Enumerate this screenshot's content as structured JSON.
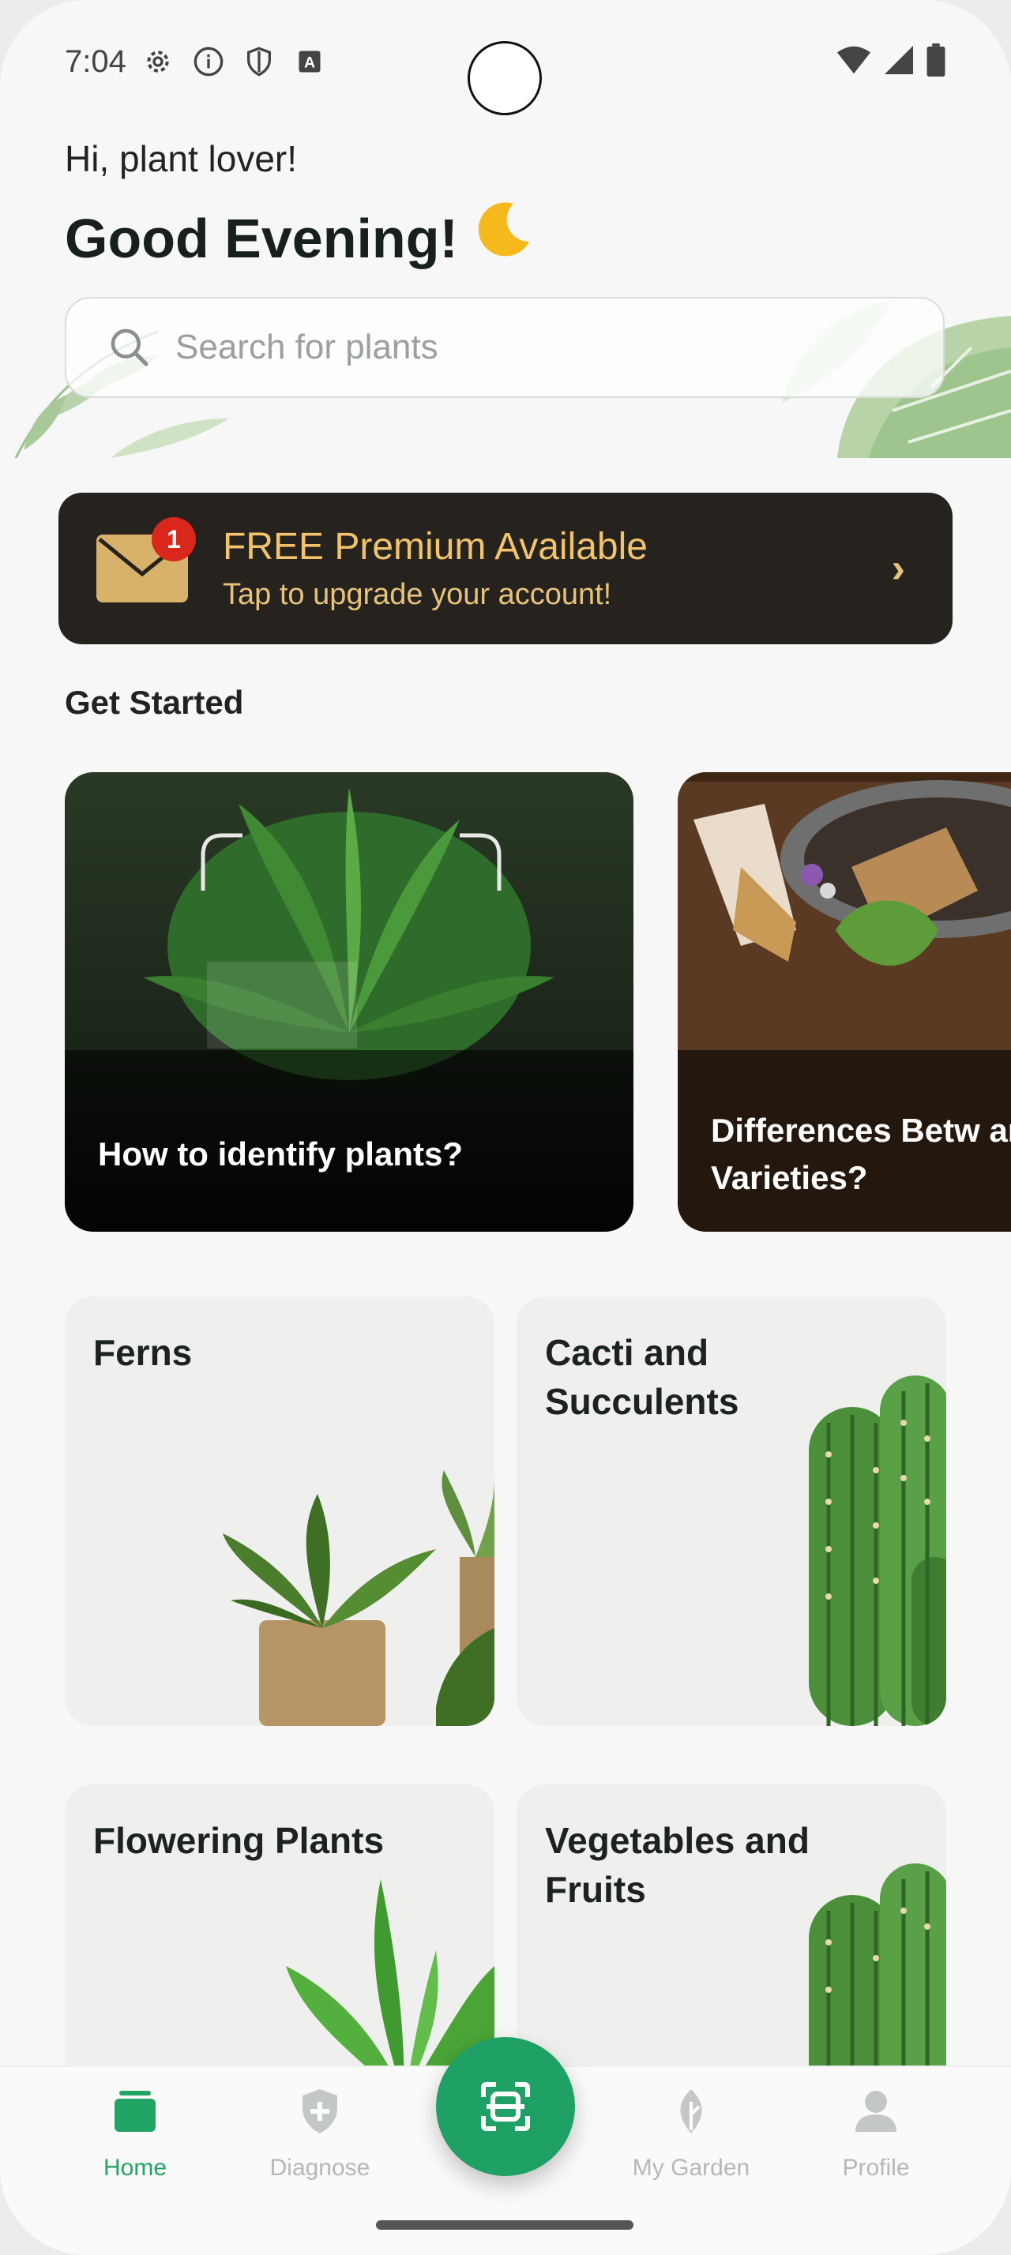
{
  "status_bar": {
    "time": "7:04"
  },
  "header": {
    "greeting": "Hi, plant lover!",
    "title": "Good Evening!"
  },
  "search": {
    "placeholder": "Search for plants"
  },
  "promo": {
    "title": "FREE Premium Available",
    "subtitle": "Tap to upgrade your account!",
    "badge_count": "1"
  },
  "get_started": {
    "heading": "Get Started",
    "cards": [
      {
        "label": "How to identify plants?"
      },
      {
        "label": "Differences Betw and Varieties?"
      }
    ]
  },
  "categories": [
    {
      "label": "Ferns"
    },
    {
      "label": "Cacti and Succulents"
    },
    {
      "label": "Flowering Plants"
    },
    {
      "label": "Vegetables and Fruits"
    }
  ],
  "bottom_nav": {
    "items": [
      {
        "label": "Home",
        "icon": "home-icon"
      },
      {
        "label": "Diagnose",
        "icon": "shield-plus-icon"
      },
      {
        "label": "My Garden",
        "icon": "leaf-icon"
      },
      {
        "label": "Profile",
        "icon": "person-icon"
      }
    ],
    "active": "Home",
    "fab_icon": "scan-icon"
  },
  "colors": {
    "accent": "#1fa065",
    "promo_bg": "#26231f",
    "promo_text": "#f2c36b"
  }
}
